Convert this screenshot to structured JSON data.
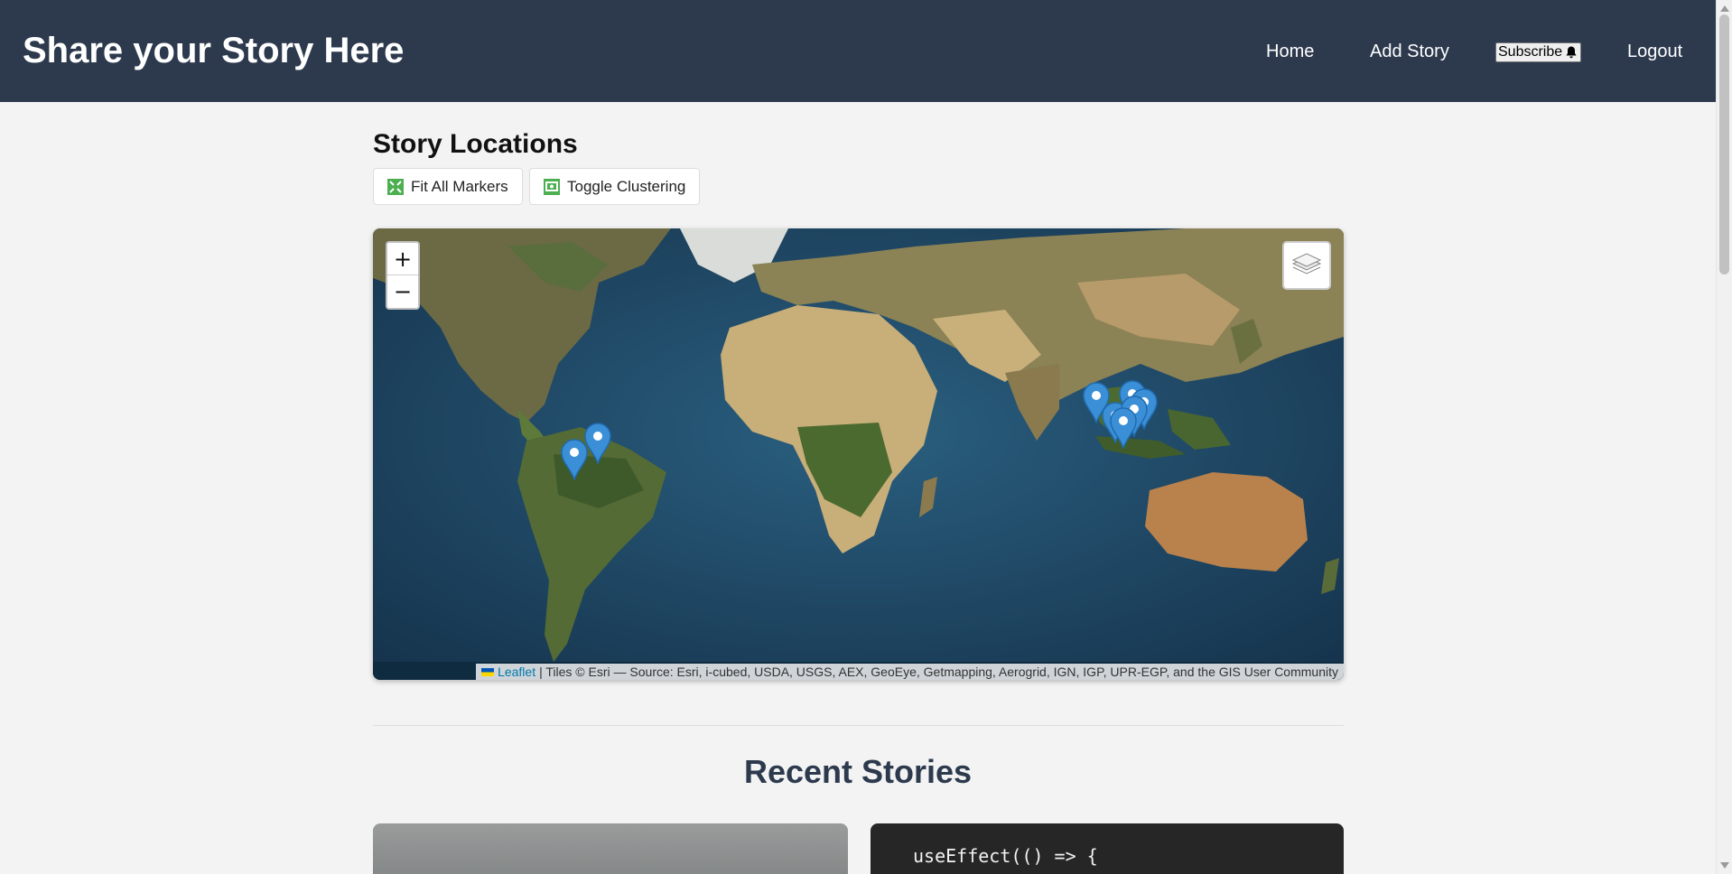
{
  "header": {
    "brand": "Share your Story Here",
    "nav": {
      "home": "Home",
      "add_story": "Add Story",
      "subscribe": "Subscribe",
      "logout": "Logout"
    }
  },
  "map_section": {
    "title": "Story Locations",
    "fit_button": "Fit All Markers",
    "cluster_button": "Toggle Clustering",
    "zoom_in": "+",
    "zoom_out": "−",
    "attribution_link": "Leaflet",
    "attribution_text": "| Tiles © Esri — Source: Esri, i-cubed, USDA, USGS, AEX, GeoEye, Getmapping, Aerogrid, IGN, IGP, UPR-EGP, and the GIS User Community",
    "marker_color": "#3b8fd6"
  },
  "recent": {
    "title": "Recent Stories",
    "code_snippet": "useEffect(() => {"
  },
  "colors": {
    "header_bg": "#2d3a4e",
    "accent_green": "#4caf50"
  }
}
